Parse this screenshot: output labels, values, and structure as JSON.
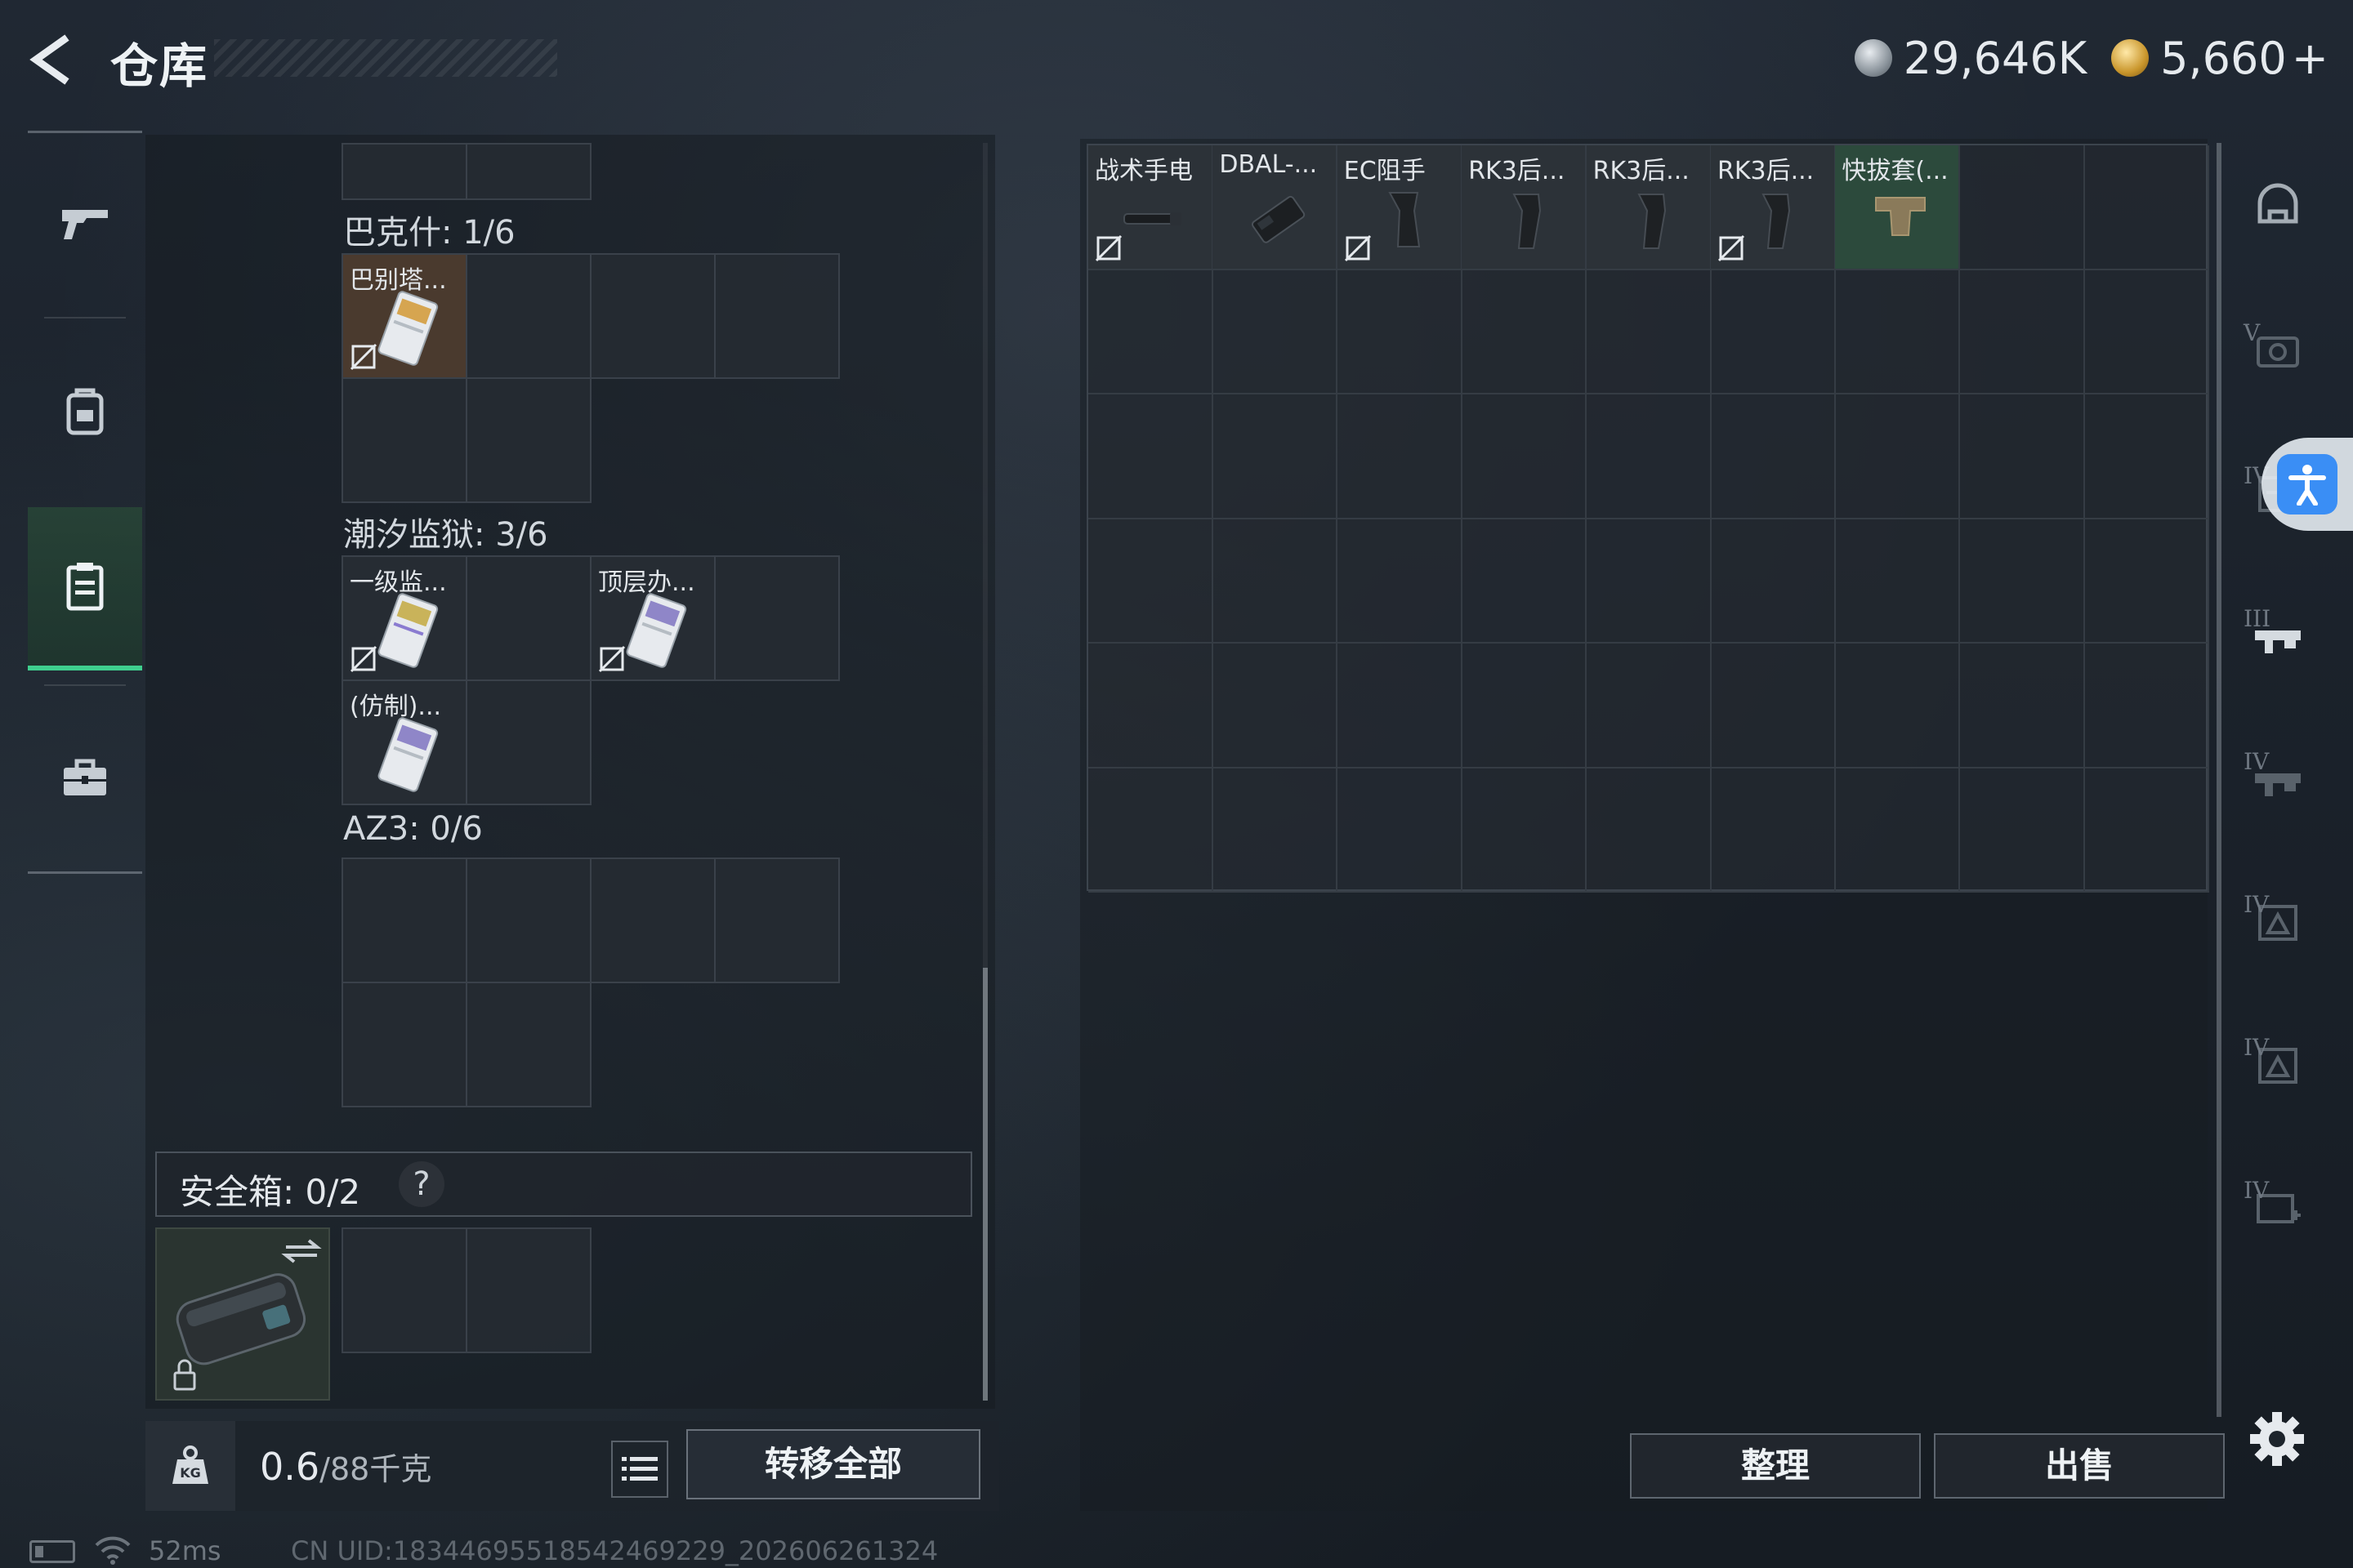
{
  "header": {
    "title": "仓库",
    "currencies": [
      {
        "icon": "silver-coin-icon",
        "value": "29,646K"
      },
      {
        "icon": "gold-coin-icon",
        "value": "5,660"
      }
    ],
    "add_label": "+"
  },
  "left_nav": {
    "items": [
      {
        "name": "weapon-tab",
        "icon": "gun-icon"
      },
      {
        "name": "backpack-tab",
        "icon": "backpack-icon"
      },
      {
        "name": "container-tab",
        "icon": "key-container-icon",
        "active": true
      },
      {
        "name": "toolbox-tab",
        "icon": "briefcase-icon"
      }
    ]
  },
  "containers": [
    {
      "label": "巴克什: 1/6",
      "items": [
        {
          "name": "巴别塔..."
        }
      ]
    },
    {
      "label": "潮汐监狱: 3/6",
      "items": [
        {
          "name": "一级监..."
        },
        {
          "name": "顶层办..."
        },
        {
          "name": "(仿制)..."
        }
      ]
    },
    {
      "label": "AZ3: 0/6",
      "items": []
    }
  ],
  "safebox": {
    "label": "安全箱: 0/2",
    "help": "?"
  },
  "bottom_left": {
    "weight_value": "0.6",
    "weight_total": "/88千克",
    "transfer_all": "转移全部"
  },
  "stash": {
    "items": [
      {
        "name": "战术手电",
        "locked": true,
        "icon": "flashlight-icon"
      },
      {
        "name": "DBAL-...",
        "locked": false,
        "icon": "laser-module-icon"
      },
      {
        "name": "EC阻手",
        "locked": true,
        "icon": "foregrip-icon"
      },
      {
        "name": "RK3后...",
        "locked": false,
        "icon": "grip-icon"
      },
      {
        "name": "RK3后...",
        "locked": false,
        "icon": "grip-icon"
      },
      {
        "name": "RK3后...",
        "locked": true,
        "icon": "grip-icon"
      },
      {
        "name": "快拔套(...",
        "locked": false,
        "icon": "holster-icon",
        "highlight": "#2c4a3c"
      }
    ],
    "sort_label": "整理",
    "sell_label": "出售"
  },
  "right_categories": [
    {
      "name": "helmet-category",
      "tier": ""
    },
    {
      "name": "armor-category",
      "tier": "V"
    },
    {
      "name": "rig-category",
      "tier": "IV"
    },
    {
      "name": "weapon-parts-category",
      "tier": "III"
    },
    {
      "name": "weapon-parts-category-2",
      "tier": "IV"
    },
    {
      "name": "ammo-category",
      "tier": "IV"
    },
    {
      "name": "ammo-category-2",
      "tier": "IV"
    },
    {
      "name": "medical-category",
      "tier": "IV"
    }
  ],
  "status": {
    "ping": "52ms",
    "uid": "CN UID:18344695518542469229_202606261324"
  },
  "colors": {
    "accent_green": "#3fcf8e",
    "accessibility_blue": "#3a8ef5"
  }
}
